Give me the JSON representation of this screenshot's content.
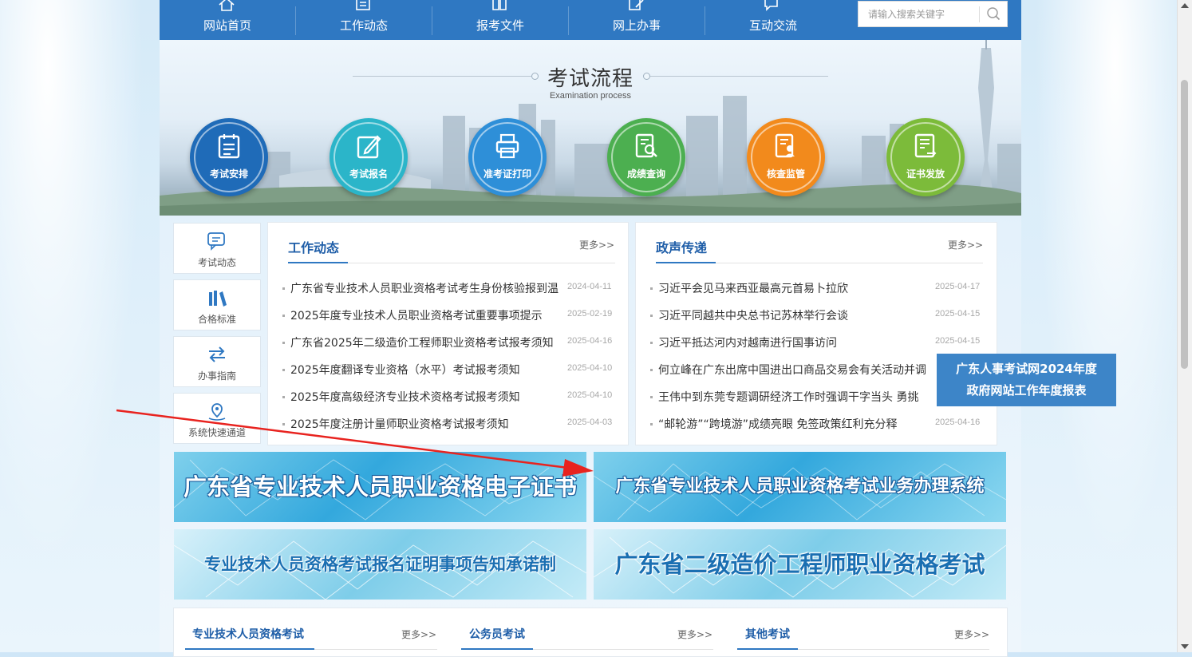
{
  "nav": {
    "items": [
      {
        "label": "网站首页",
        "icon": "home-icon"
      },
      {
        "label": "工作动态",
        "icon": "news-icon"
      },
      {
        "label": "报考文件",
        "icon": "document-icon"
      },
      {
        "label": "网上办事",
        "icon": "edit-icon"
      },
      {
        "label": "互动交流",
        "icon": "chat-icon"
      }
    ],
    "search_placeholder": "请输入搜索关键字"
  },
  "banner": {
    "title": "考试流程",
    "subtitle": "Examination process",
    "steps": [
      {
        "label": "考试安排",
        "color": "#1f6bb8",
        "icon": "calendar-icon"
      },
      {
        "label": "考试报名",
        "color": "#2bb5c9",
        "icon": "pen-icon"
      },
      {
        "label": "准考证打印",
        "color": "#2e8fd8",
        "icon": "printer-icon"
      },
      {
        "label": "成绩查询",
        "color": "#4caf50",
        "icon": "search-doc-icon"
      },
      {
        "label": "核查监管",
        "color": "#f28a1c",
        "icon": "verify-icon"
      },
      {
        "label": "证书发放",
        "color": "#7cbb3a",
        "icon": "certificate-icon"
      }
    ]
  },
  "side": [
    {
      "label": "考试动态",
      "icon": "message-icon"
    },
    {
      "label": "合格标准",
      "icon": "books-icon"
    },
    {
      "label": "办事指南",
      "icon": "exchange-icon"
    },
    {
      "label": "系统快速通道",
      "icon": "map-pin-icon"
    }
  ],
  "work": {
    "title": "工作动态",
    "more": "更多>>",
    "items": [
      {
        "text": "广东省专业技术人员职业资格考试考生身份核验报到温",
        "date": "2024-04-11"
      },
      {
        "text": "2025年度专业技术人员职业资格考试重要事项提示",
        "date": "2025-02-19"
      },
      {
        "text": "广东省2025年二级造价工程师职业资格考试报考须知",
        "date": "2025-04-16"
      },
      {
        "text": "2025年度翻译专业资格（水平）考试报考须知",
        "date": "2025-04-10"
      },
      {
        "text": "2025年度高级经济专业技术资格考试报考须知",
        "date": "2025-04-10"
      },
      {
        "text": "2025年度注册计量师职业资格考试报考须知",
        "date": "2025-04-03"
      }
    ]
  },
  "gov": {
    "title": "政声传递",
    "more": "更多>>",
    "items": [
      {
        "text": "习近平会见马来西亚最高元首易卜拉欣",
        "date": "2025-04-17"
      },
      {
        "text": "习近平同越共中央总书记苏林举行会谈",
        "date": "2025-04-15"
      },
      {
        "text": "习近平抵达河内对越南进行国事访问",
        "date": "2025-04-15"
      },
      {
        "text": "何立峰在广东出席中国进出口商品交易会有关活动并调",
        "date": ""
      },
      {
        "text": "王伟中到东莞专题调研经济工作时强调干字当头 勇挑",
        "date": ""
      },
      {
        "text": "“邮轮游”“跨境游”成绩亮眼 免签政策红利充分释",
        "date": "2025-04-16"
      }
    ]
  },
  "promo": {
    "line1": "广东人事考试网2024年度",
    "line2": "政府网站工作年度报表"
  },
  "tiles": [
    {
      "text": "广东省专业技术人员职业资格电子证书"
    },
    {
      "text": "广东省专业技术人员职业资格考试业务办理系统"
    },
    {
      "text": "专业技术人员资格考试报名证明事项告知承诺制"
    },
    {
      "text": "广东省二级造价工程师职业资格考试"
    }
  ],
  "bottom": {
    "tabs": [
      {
        "label": "专业技术人员资格考试",
        "more": "更多>>"
      },
      {
        "label": "公务员考试",
        "more": "更多>>"
      },
      {
        "label": "其他考试",
        "more": "更多>>"
      }
    ]
  },
  "colors": {
    "nav_bg": "#2f78c2",
    "title_blue": "#1f5ea8",
    "annotation_arrow": "#e8231f"
  }
}
